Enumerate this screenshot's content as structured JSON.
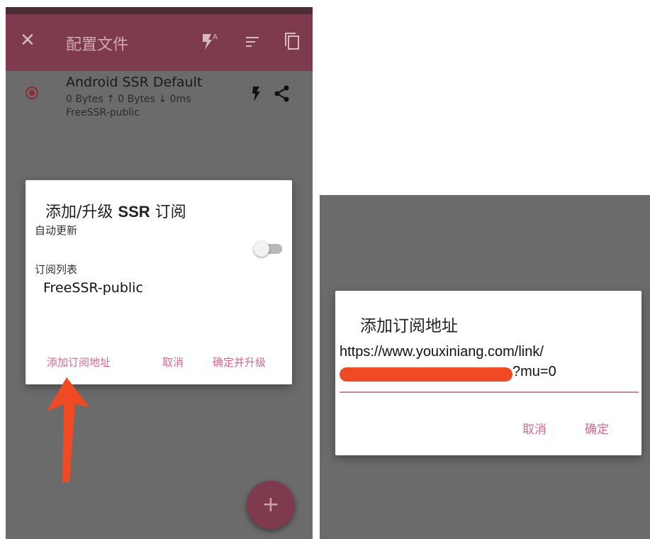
{
  "left_screen": {
    "toolbar": {
      "title": "配置文件",
      "icons": [
        "close-icon",
        "flash-auto-icon",
        "sort-icon",
        "copy-icon"
      ]
    },
    "profile": {
      "name": "Android SSR Default",
      "traffic": "0 Bytes ↑ 0 Bytes ↓ 0ms",
      "group": "FreeSSR-public",
      "icons": [
        "flash-icon",
        "share-icon"
      ]
    },
    "dialog": {
      "title_prefix": "添加/升级 ",
      "title_bold": "SSR",
      "title_suffix": " 订阅",
      "auto_update_label": "自动更新",
      "auto_update_enabled": false,
      "subscription_list_label": "订阅列表",
      "subscriptions": [
        "FreeSSR-public"
      ],
      "buttons": {
        "add": "添加订阅地址",
        "cancel": "取消",
        "confirm": "确定并升级"
      }
    },
    "fab_label": "+",
    "annotation_arrow_color": "#f04a24"
  },
  "right_screen": {
    "dialog": {
      "title": "添加订阅地址",
      "url_line1": "https://www.youxiniang.com/link/",
      "url_line2_suffix": "?mu=0",
      "buttons": {
        "cancel": "取消",
        "confirm": "确定"
      }
    }
  },
  "colors": {
    "toolbar": "#7d3b4d",
    "accent_text": "#d6688c",
    "dim_overlay": "#6b6b6b",
    "redaction": "#f04a24"
  }
}
